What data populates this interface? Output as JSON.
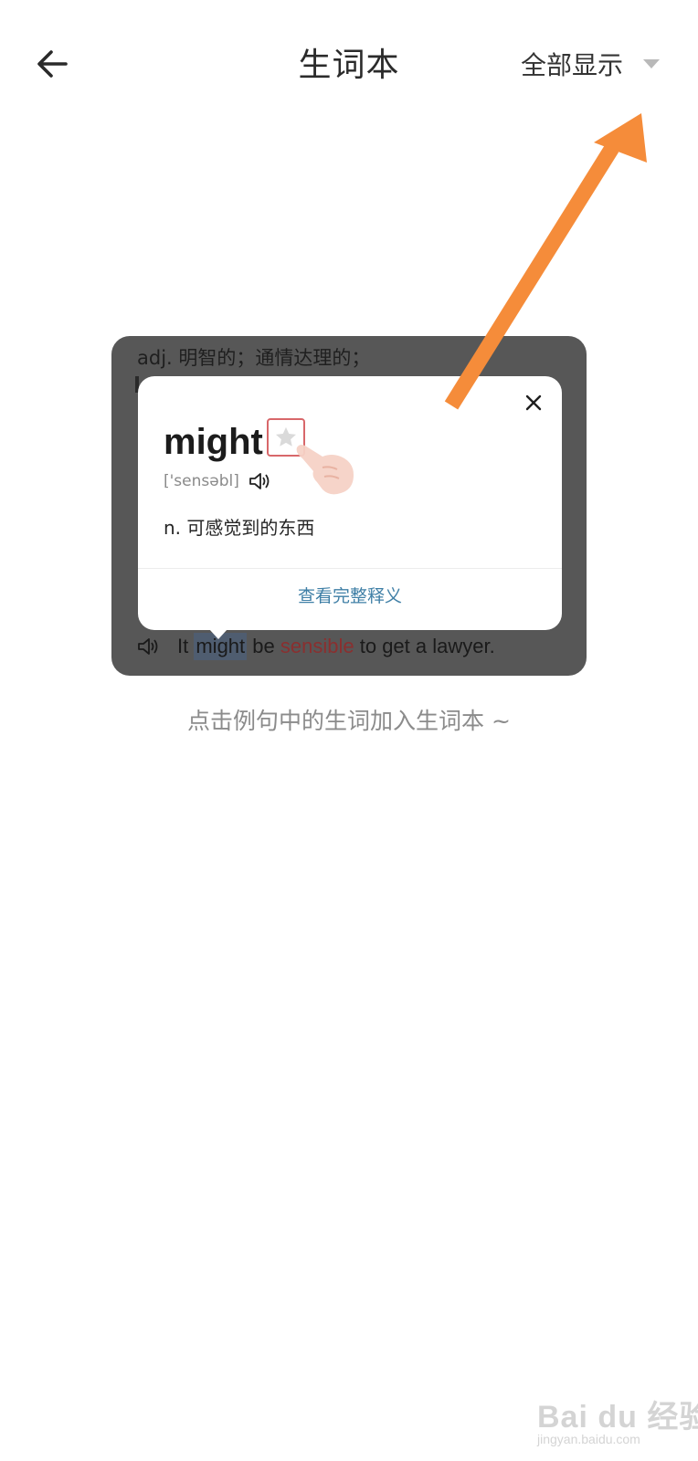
{
  "header": {
    "title": "生词本",
    "filter_label": "全部显示",
    "back_icon": "arrow-left-icon",
    "filter_icon": "caret-down-icon"
  },
  "illustration": {
    "top_definition": "adj. 明智的；通情达理的；",
    "sentence": {
      "before": "It",
      "highlighted": "might",
      "middle": "be",
      "emphasized": "sensible",
      "after": "to get a lawyer."
    },
    "popup": {
      "word": "might",
      "phonetic": "['sensəbl]",
      "meaning": "n. 可感觉到的东西",
      "full_definition_link": "查看完整释义",
      "star_icon": "star-icon",
      "close_icon": "close-icon",
      "speaker_icon": "speaker-icon"
    }
  },
  "empty_hint": "点击例句中的生词加入生词本 ~",
  "watermark": {
    "text": "Bai du 经验",
    "url": "jingyan.baidu.com"
  },
  "colors": {
    "arrow": "#f58c3a",
    "link": "#3f7fa6",
    "star_border": "#d8676a",
    "card_bg": "#575757"
  }
}
